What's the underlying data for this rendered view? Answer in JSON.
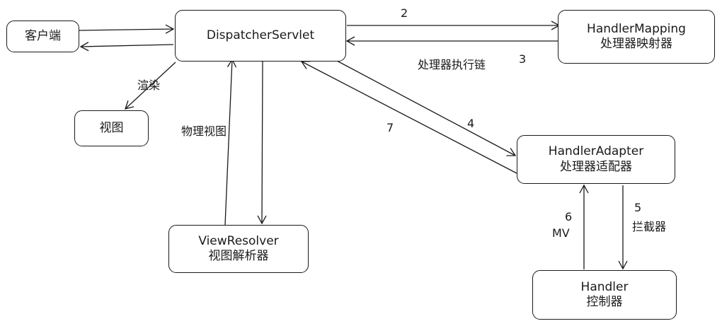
{
  "nodes": {
    "client": "客户端",
    "dispatcher": "DispatcherServlet",
    "handler_mapping": {
      "name": "HandlerMapping",
      "cn": "处理器映射器"
    },
    "handler_adapter": {
      "name": "HandlerAdapter",
      "cn": "处理器适配器"
    },
    "view_resolver": {
      "name": "ViewResolver",
      "cn": "视图解析器"
    },
    "handler": {
      "name": "Handler",
      "cn": "控制器"
    },
    "view": "视图"
  },
  "edge_labels": {
    "step2": "2",
    "step3": "3",
    "execution_chain": "处理器执行链",
    "step4": "4",
    "step7": "7",
    "step5": "5",
    "interceptor": "拦截器",
    "step6": "6",
    "mv": "MV",
    "render": "渲染",
    "physical_view": "物理视图"
  }
}
